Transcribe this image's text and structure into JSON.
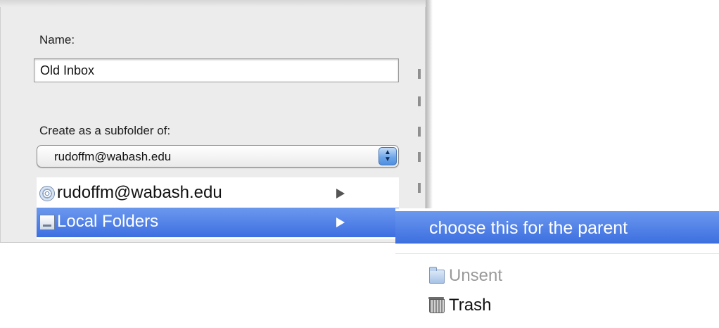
{
  "dialog": {
    "name_label": "Name:",
    "name_value": "Old Inbox",
    "subfolder_label": "Create as a subfolder of:",
    "parent_selected": "rudoffm@wabash.edu"
  },
  "popup_menu": {
    "items": [
      {
        "label": "rudoffm@wabash.edu",
        "icon": "account-globe-icon",
        "has_submenu": true,
        "selected": false
      },
      {
        "label": "Local Folders",
        "icon": "local-folders-icon",
        "has_submenu": true,
        "selected": true
      }
    ]
  },
  "submenu": {
    "choose_label": "choose this for the parent",
    "items": [
      {
        "label": "Unsent",
        "icon": "folder-icon",
        "disabled": true
      },
      {
        "label": "Trash",
        "icon": "trash-icon",
        "disabled": false
      }
    ]
  },
  "colors": {
    "selection": "#3d6fe0",
    "dialog_bg": "#ececec"
  }
}
